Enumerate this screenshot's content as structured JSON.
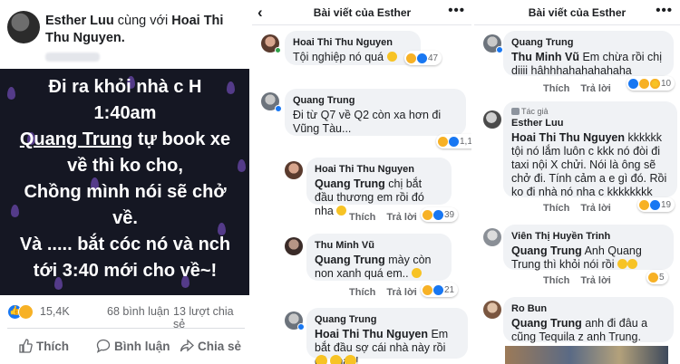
{
  "post": {
    "author": "Esther Luu",
    "connector": "cùng với",
    "tagged": "Hoai Thi Thu Nguyen.",
    "image_text": {
      "line1": "Đi ra khỏi nhà c H",
      "line2": "1:40am",
      "line3_name": "Quang Trung",
      "line3_rest": " tự book xe",
      "line4": "về thì ko cho,",
      "line5": "Chồng mình nói sẽ chở",
      "line6": "về.",
      "line7": "Và ..... bắt cóc nó và nch",
      "line8": "tới  3:40 mới cho về~!"
    },
    "stats": {
      "reactions": "15,4K",
      "comments": "68 bình luận",
      "shares": "13 lượt chia sẻ"
    },
    "actions": {
      "like": "Thích",
      "comment": "Bình luận",
      "share": "Chia sẻ"
    }
  },
  "thread_left": {
    "header": {
      "back": "‹",
      "title": "Bài viết của Esther",
      "more": "•••"
    },
    "comments": [
      {
        "name": "Hoai Thi Thu Nguyen",
        "text": "Tội nghiệp nó quá",
        "reactions": "47"
      },
      {
        "name": "Quang Trung",
        "text": "Đi từ Q7 về Q2 còn xa hơn đi Vũng Tàu...",
        "reactions": "1,1K"
      },
      {
        "name": "Hoai Thi Thu Nguyen",
        "mention": "Quang Trung",
        "text": " chị bắt đầu thương em rồi đó nha",
        "like": "Thích",
        "reply": "Trả lời",
        "reactions": "39"
      },
      {
        "name": "Thu Minh Vũ",
        "mention": "Quang Trung",
        "text": " mày còn non xanh quá em..",
        "like": "Thích",
        "reply": "Trả lời",
        "reactions": "21"
      },
      {
        "name": "Quang Trung",
        "mention": "Hoai Thi Thu Nguyen",
        "text": " Em bắt đầu sợ cái nhà này rồi đó nha!!!"
      }
    ]
  },
  "thread_right": {
    "header": {
      "title": "Bài viết của Esther",
      "more": "•••"
    },
    "comments": [
      {
        "name": "Quang Trung",
        "mention": "Thu Minh Vũ",
        "text": " Em chừa rồi chị diiii hâhhhahahahahaha",
        "like": "Thích",
        "reply": "Trả lời",
        "reactions": "10"
      },
      {
        "tag": "Tác giả",
        "name": "Esther Luu",
        "mention": "Hoai Thi Thu Nguyen",
        "text": " kkkkkk tội nó lắm luôn c kkk nó đòi đi taxi nội X chửi. Nói là ông sẽ chở đi. Tính cảm a e gì đó. Rồi ko đi nhà nó nha c kkkkkkkk",
        "like": "Thích",
        "reply": "Trả lời",
        "reactions": "19"
      },
      {
        "name": "Viên Thị Huyền Trinh",
        "mention": "Quang Trung",
        "text": " Anh Quang Trung thì khỏi nói rồi",
        "like": "Thích",
        "reply": "Trả lời",
        "reactions": "5"
      },
      {
        "name": "Ro Bun",
        "mention": "Quang Trung",
        "text": " anh đi đâu a cũng Tequila z anh Trung."
      }
    ]
  }
}
